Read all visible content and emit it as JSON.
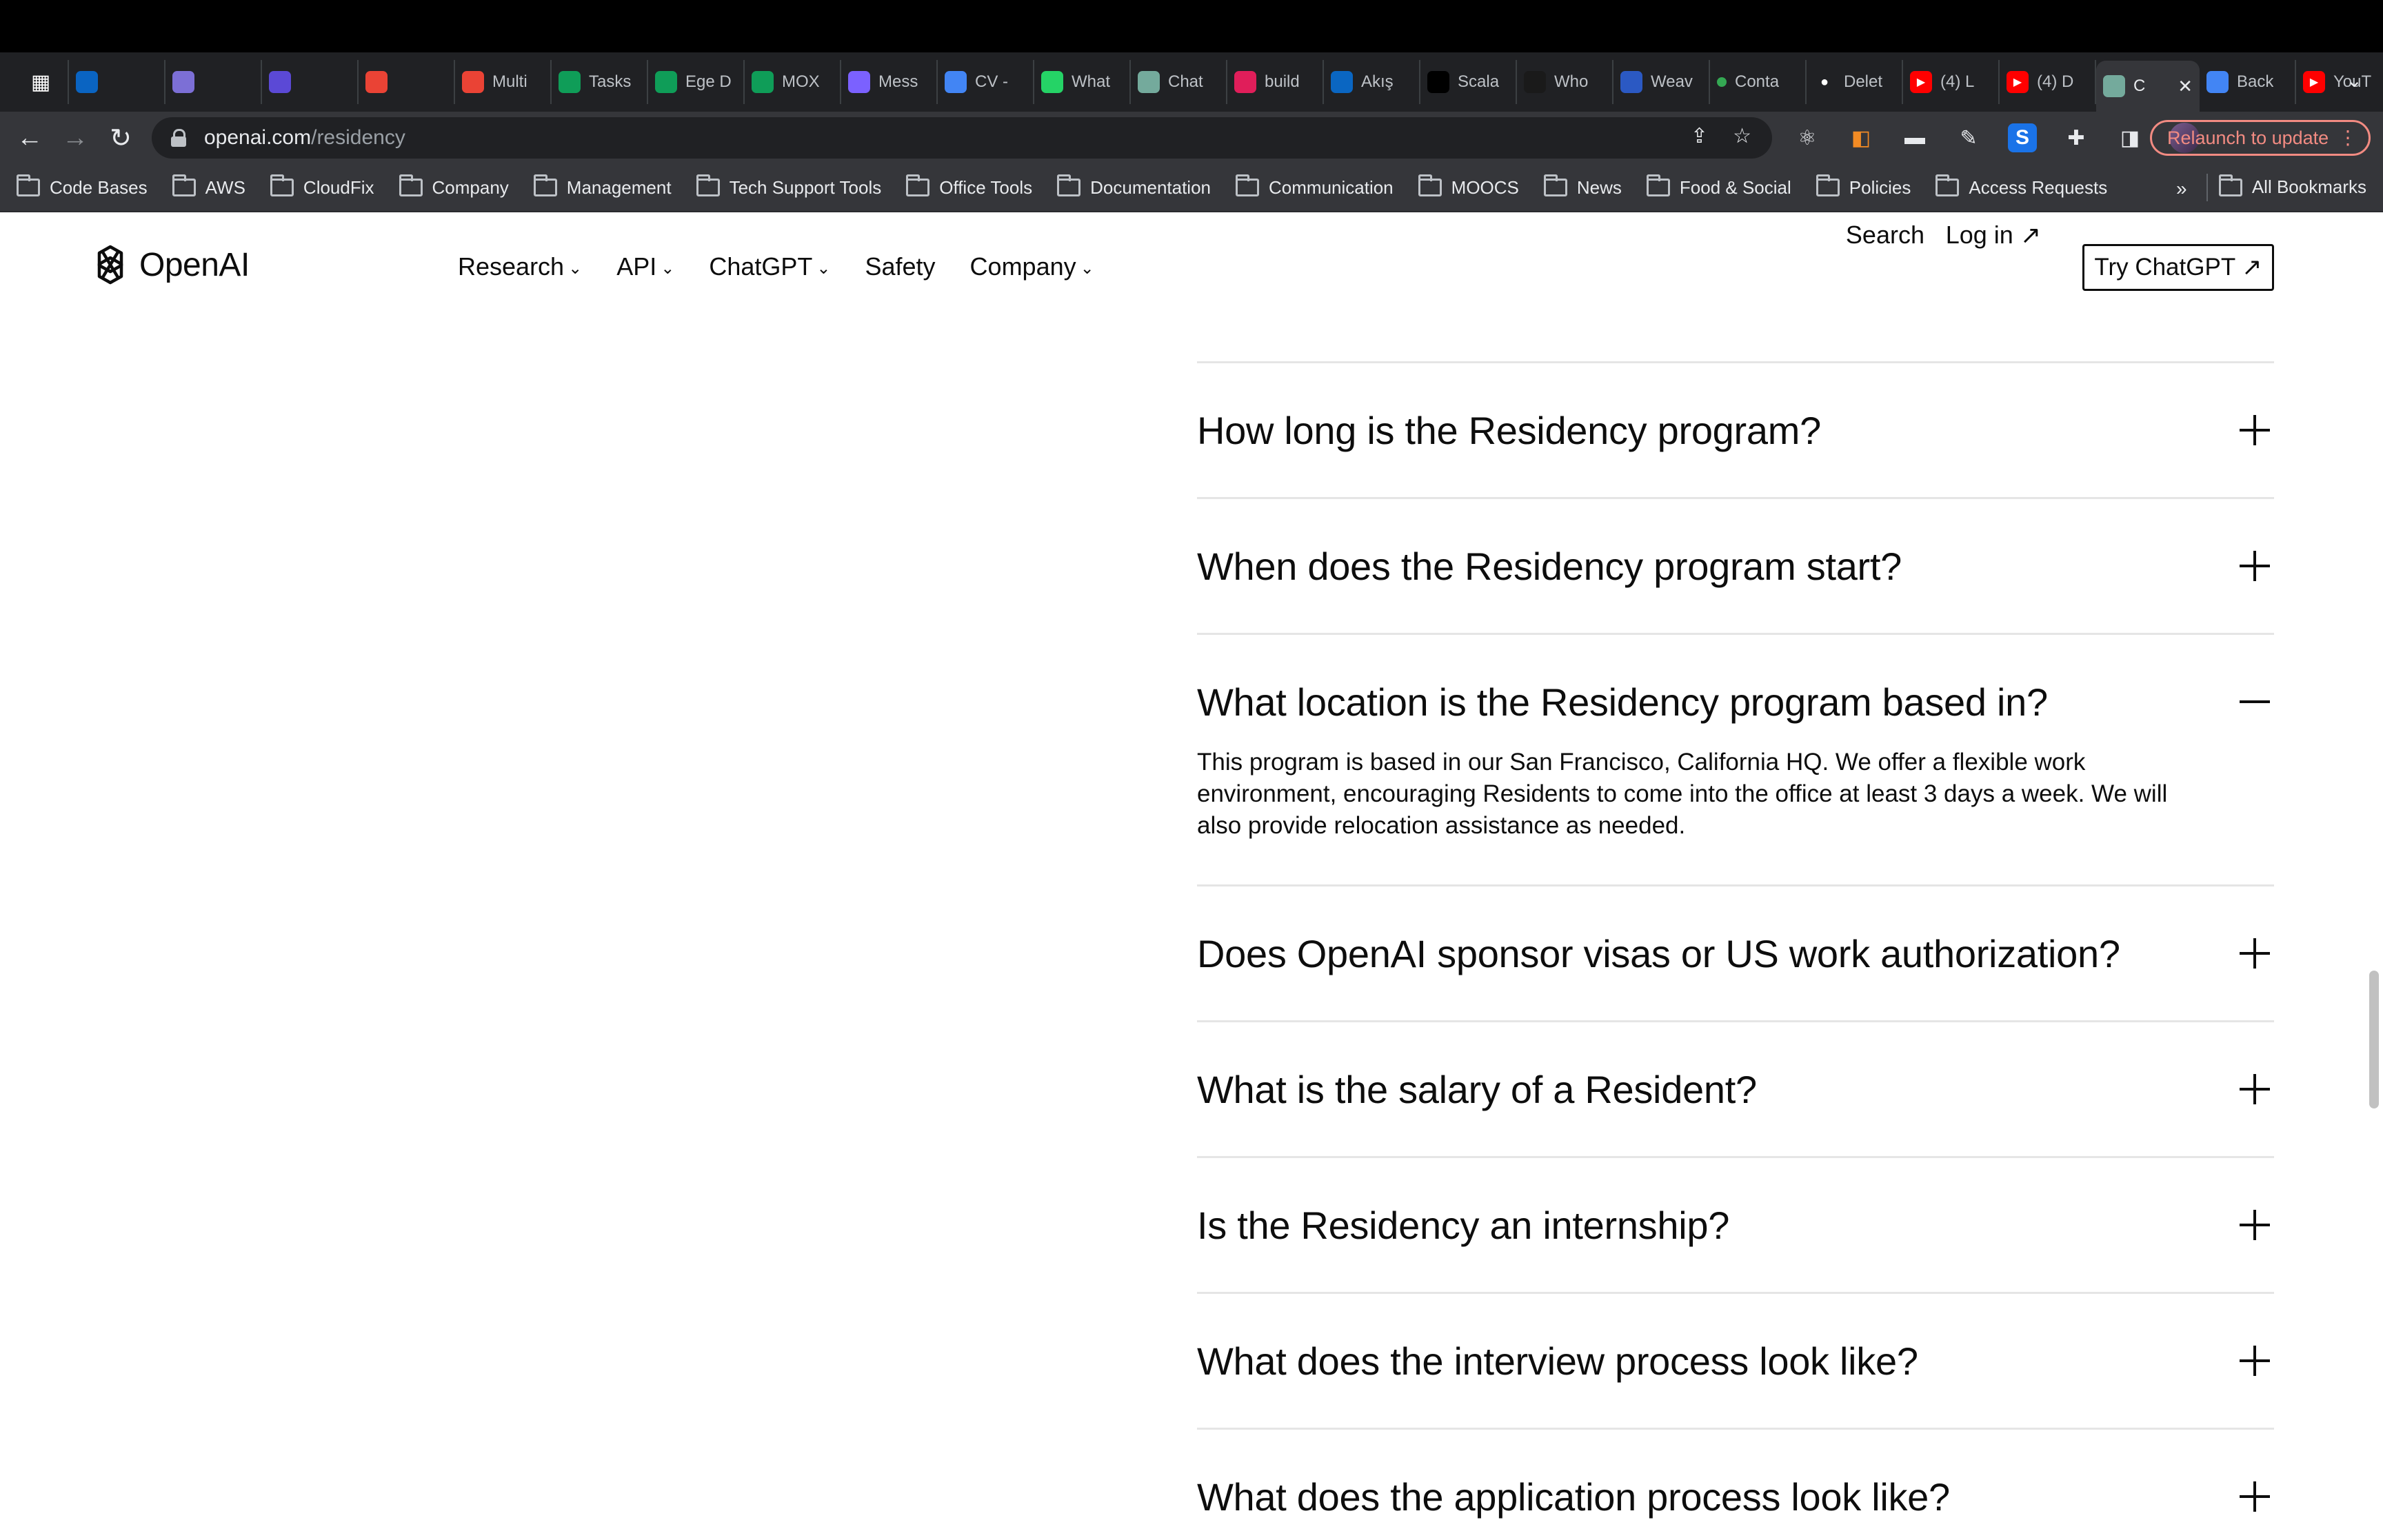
{
  "browser": {
    "tabs": [
      {
        "label": "",
        "icon": "apps-grid-icon",
        "color": "#ffffff"
      },
      {
        "label": "",
        "icon": "outlook-icon",
        "color": "#0a64c2"
      },
      {
        "label": "",
        "icon": "circle-logo-icon",
        "color": "#7c6fd6"
      },
      {
        "label": "",
        "icon": "toggl-icon",
        "color": "#5b49d6"
      },
      {
        "label": "",
        "icon": "gmail-icon",
        "color": "#ea4335"
      },
      {
        "label": "Multi",
        "icon": "gmail-icon",
        "color": "#ea4335"
      },
      {
        "label": "Tasks",
        "icon": "tasks-icon",
        "color": "#0f9d58"
      },
      {
        "label": "Ege D",
        "icon": "sheets-icon",
        "color": "#0f9d58"
      },
      {
        "label": "MOX",
        "icon": "sheets-icon",
        "color": "#0f9d58"
      },
      {
        "label": "Mess",
        "icon": "messenger-icon",
        "color": "#7b61ff"
      },
      {
        "label": "CV -",
        "icon": "docs-icon",
        "color": "#4285f4"
      },
      {
        "label": "What",
        "icon": "whatsapp-icon",
        "color": "#25d366"
      },
      {
        "label": "Chat",
        "icon": "openai-icon",
        "color": "#74aa9c"
      },
      {
        "label": "build",
        "icon": "slack-icon",
        "color": "#e01e5a"
      },
      {
        "label": "Akış",
        "icon": "linkedin-icon",
        "color": "#0a66c2"
      },
      {
        "label": "Scala",
        "icon": "medium-icon",
        "color": "#000000"
      },
      {
        "label": "Who",
        "icon": "vercel-icon",
        "color": "#1a1a1a"
      },
      {
        "label": "Weav",
        "icon": "weave-icon",
        "color": "#2b59c3"
      },
      {
        "label": "Conta",
        "icon": "green-dot-icon",
        "color": "#34a853"
      },
      {
        "label": "Delet",
        "icon": "github-icon",
        "color": "#ffffff"
      },
      {
        "label": "(4) L",
        "icon": "youtube-icon",
        "color": "#ff0000"
      },
      {
        "label": "(4) D",
        "icon": "youtube-icon",
        "color": "#ff0000"
      },
      {
        "label": "C",
        "icon": "openai-icon",
        "color": "#74aa9c",
        "active": true
      },
      {
        "label": "Back",
        "icon": "docs-icon",
        "color": "#4285f4"
      },
      {
        "label": "YouT",
        "icon": "youtube-icon",
        "color": "#ff0000"
      }
    ],
    "url_host": "openai.com",
    "url_path": "/residency",
    "relaunch_label": "Relaunch to update",
    "bookmarks": [
      "Code Bases",
      "AWS",
      "CloudFix",
      "Company",
      "Management",
      "Tech Support Tools",
      "Office Tools",
      "Documentation",
      "Communication",
      "MOOCS",
      "News",
      "Food & Social",
      "Policies",
      "Access Requests"
    ],
    "bookmarks_more": "»",
    "all_bookmarks": "All Bookmarks"
  },
  "site": {
    "logo_text": "OpenAI",
    "nav": [
      {
        "label": "Research",
        "dropdown": true
      },
      {
        "label": "API",
        "dropdown": true
      },
      {
        "label": "ChatGPT",
        "dropdown": true
      },
      {
        "label": "Safety",
        "dropdown": false
      },
      {
        "label": "Company",
        "dropdown": true
      }
    ],
    "search_label": "Search",
    "login_label": "Log in ↗",
    "try_label": "Try ChatGPT ↗"
  },
  "faq": [
    {
      "question": "How long is the Residency program?",
      "expanded": false
    },
    {
      "question": "When does the Residency program start?",
      "expanded": false
    },
    {
      "question": "What location is the Residency program based in?",
      "expanded": true,
      "answer": "This program is based in our San Francisco, California HQ. We offer a flexible work environment, encouraging Residents to come into the office at least 3 days a week. We will also provide relocation assistance as needed."
    },
    {
      "question": "Does OpenAI sponsor visas or US work authorization?",
      "expanded": false
    },
    {
      "question": "What is the salary of a Resident?",
      "expanded": false
    },
    {
      "question": "Is the Residency an internship?",
      "expanded": false
    },
    {
      "question": "What does the interview process look like?",
      "expanded": false
    },
    {
      "question": "What does the application process look like?",
      "expanded": false
    }
  ]
}
